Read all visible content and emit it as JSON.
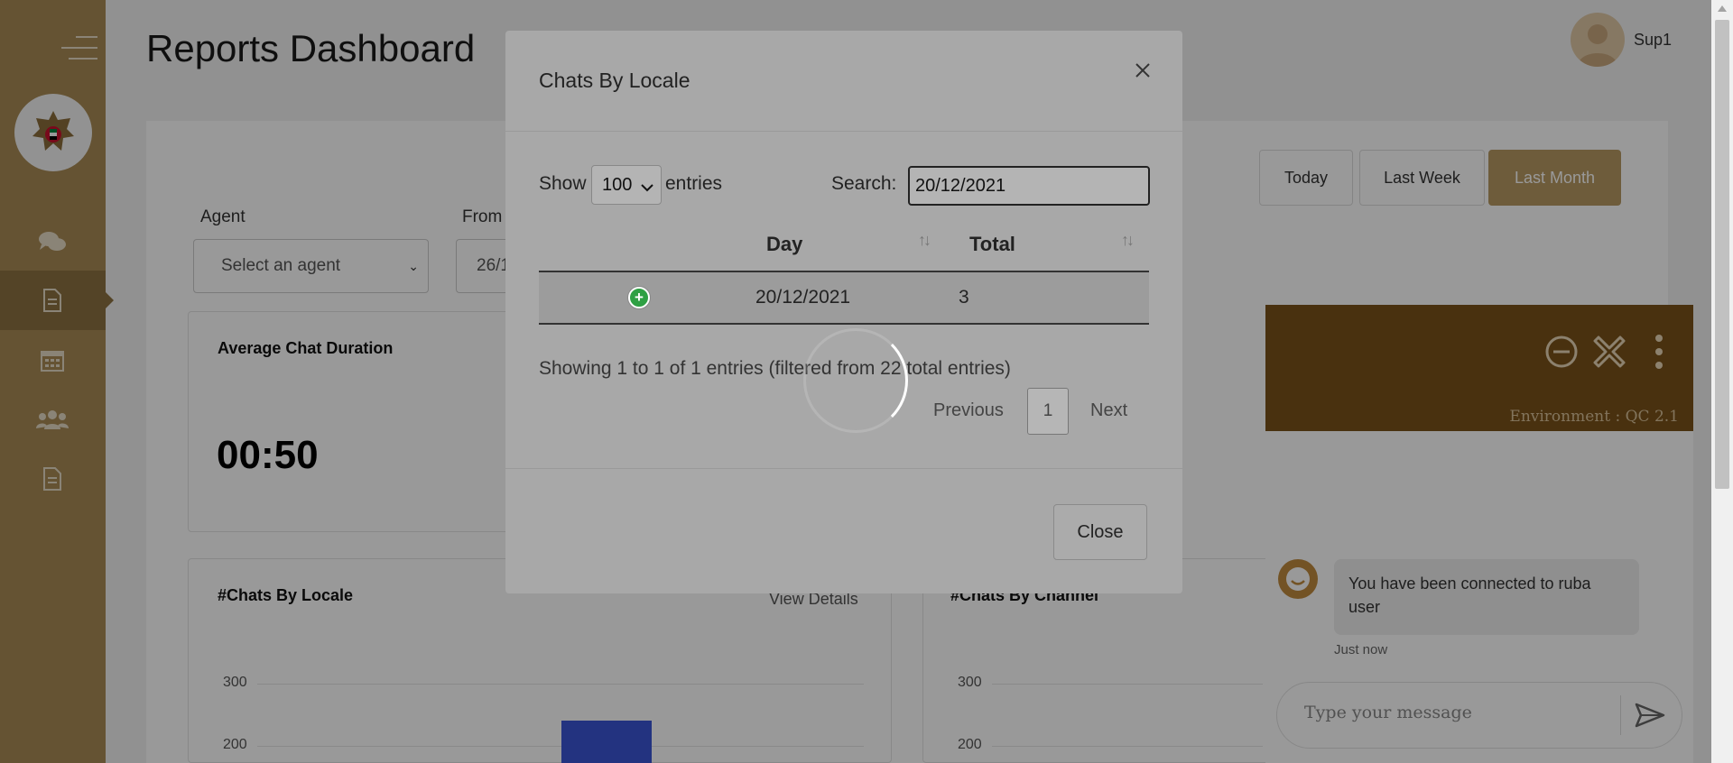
{
  "page": {
    "title": "Reports Dashboard"
  },
  "user": {
    "name": "Sup1"
  },
  "sidebar": {
    "items": [
      {
        "icon": "chat-bubbles-icon"
      },
      {
        "icon": "document-icon"
      },
      {
        "icon": "calendar-icon"
      },
      {
        "icon": "users-icon"
      },
      {
        "icon": "report-icon"
      }
    ],
    "active_index": 1
  },
  "date_range": {
    "today": "Today",
    "last_week": "Last Week",
    "last_month": "Last Month",
    "selected": "Last Month"
  },
  "filters": {
    "agent_label": "Agent",
    "agent_placeholder": "Select an agent",
    "from_label": "From",
    "from_value": "26/1"
  },
  "cards": {
    "avg_duration": {
      "title": "Average Chat Duration",
      "value": "00:50"
    },
    "chats_by_locale": {
      "title": "#Chats By Locale",
      "link": "View Details",
      "ticks": [
        "300",
        "200"
      ]
    },
    "chats_by_channel": {
      "title": "#Chats By Channel",
      "ticks": [
        "300",
        "200"
      ]
    }
  },
  "chat_widget": {
    "environment": "Environment : QC 2.1",
    "message": "You have been connected to ruba user",
    "time": "Just now",
    "input_placeholder": "Type your message"
  },
  "modal": {
    "title": "Chats By Locale",
    "show_label": "Show",
    "page_length": "100",
    "entries_label": "entries",
    "search_label": "Search:",
    "search_value": "20/12/2021",
    "columns": [
      "Day",
      "Total"
    ],
    "rows": [
      {
        "day": "20/12/2021",
        "total": "3"
      }
    ],
    "info": "Showing 1 to 1 of 1 entries (filtered from 22 total entries)",
    "previous": "Previous",
    "current_page": "1",
    "next": "Next",
    "close_label": "Close"
  },
  "colors": {
    "sidebar": "#a88a55",
    "accent": "#b79a63",
    "chat_header": "#7a5319",
    "bar": "#3b55d6",
    "expand": "#2ea043"
  }
}
